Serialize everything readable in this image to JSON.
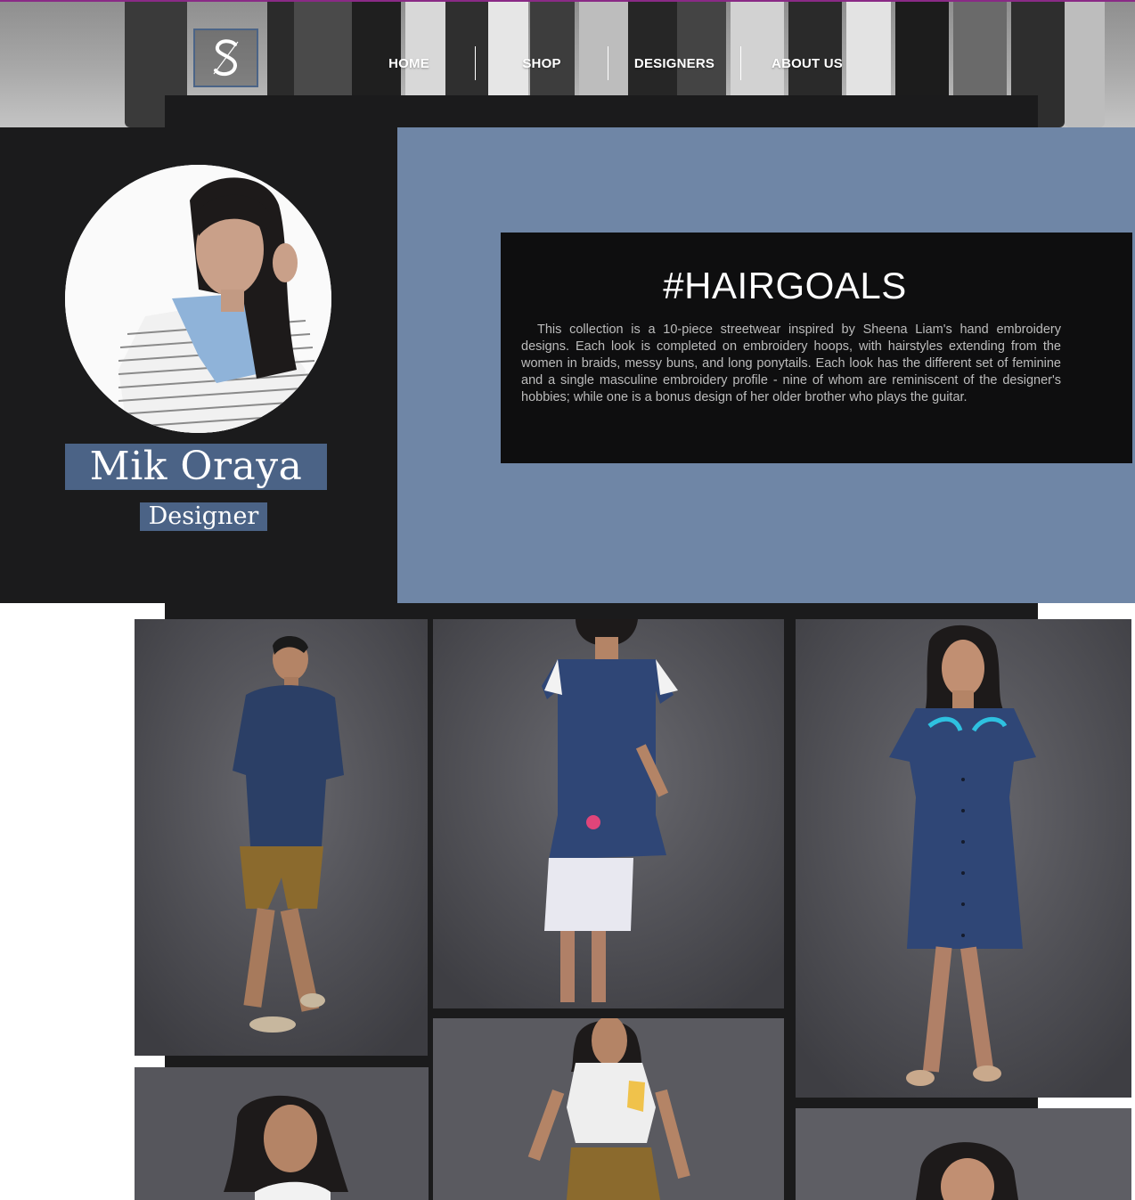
{
  "header": {
    "logo": {
      "letter": "S",
      "icon": "s-monogram-logo-icon"
    },
    "nav": [
      {
        "label": "HOME"
      },
      {
        "label": "SHOP"
      },
      {
        "label": "DESIGNERS"
      },
      {
        "label": "ABOUT US"
      }
    ]
  },
  "profile": {
    "name": "Mik Oraya",
    "role": "Designer"
  },
  "collection": {
    "title": "#HAIRGOALS",
    "description": "This collection is a 10-piece streetwear inspired by Sheena Liam's hand embroidery designs. Each look is completed on embroidery hoops, with hairstyles extending from the women in braids, messy buns, and long ponytails. Each look has the different set of feminine and a single masculine embroidery profile - nine of whom are reminiscent of the designer's hobbies; while one is a bonus design of her older brother who plays the guitar."
  },
  "colors": {
    "accent_line": "#8a2a86",
    "dark_panel": "#1b1b1c",
    "blue_panel": "#6f86a6",
    "badge_blue": "#4b6386",
    "text_box": "#0e0e0f"
  }
}
